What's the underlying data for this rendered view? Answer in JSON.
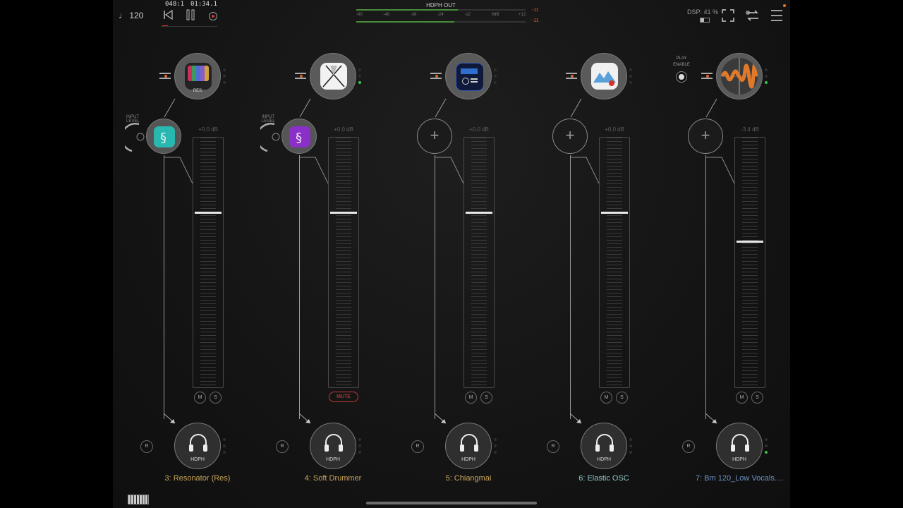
{
  "topbar": {
    "tempo": "♩ 120",
    "bars_position": "048:1",
    "time_position": "01:34.1",
    "meter": {
      "title": "HDPH OUT",
      "scale": [
        "-60",
        "-48",
        "-36",
        "-24",
        "-12",
        "0dB",
        "+12"
      ],
      "peak_top": "-11",
      "peak_bottom": "-11",
      "level_top": 0.6,
      "level_bottom": 0.58
    },
    "dsp": "DSP: 41 %"
  },
  "play_enable": "PLAY\nENABLE",
  "channels": [
    {
      "name": "3: Resonator (Res)",
      "name_color": "#c9a55a",
      "plugin_label": "RES",
      "plugin_icon": "resonator-icon",
      "input_level_label": "INPUT LEVEL",
      "insert_icon": "teal-audio-icon",
      "db": "+0.0 dB",
      "mute": "M",
      "solo": "S",
      "record": "R",
      "output": "HDPH",
      "fader_level": 0.7
    },
    {
      "name": "4: Soft Drummer",
      "name_color": "#c9a55a",
      "plugin_label": "",
      "plugin_icon": "drumsticks-icon",
      "input_level_label": "INPUT LEVEL",
      "insert_icon": "purple-audio-icon",
      "db": "+0.0 dB",
      "mute": "MUTE",
      "solo": "",
      "record": "R",
      "output": "HDPH",
      "fader_level": 0.7
    },
    {
      "name": "5: Chiangmai",
      "name_color": "#c9a55a",
      "plugin_label": "",
      "plugin_icon": "synth-panel-icon",
      "input_level_label": "",
      "insert_icon": "plus-icon",
      "db": "+0.0 dB",
      "mute": "M",
      "solo": "S",
      "record": "R",
      "output": "HDPH",
      "fader_level": 0.7
    },
    {
      "name": "6: Elastic OSC",
      "name_color": "#8fc6c9",
      "plugin_label": "",
      "plugin_icon": "mountain-wave-icon",
      "input_level_label": "",
      "insert_icon": "plus-icon",
      "db": "+0.0 dB",
      "mute": "M",
      "solo": "S",
      "record": "R",
      "output": "HDPH",
      "fader_level": 0.7
    },
    {
      "name": "7: Bm 120_Low Vocals....",
      "name_color": "#6f93c4",
      "plugin_label": "",
      "plugin_icon": "waveform-icon",
      "input_level_label": "",
      "insert_icon": "plus-icon",
      "db": "-3.4 dB",
      "mute": "M",
      "solo": "S",
      "record": "R",
      "output": "HDPH",
      "fader_level": 0.58
    }
  ]
}
